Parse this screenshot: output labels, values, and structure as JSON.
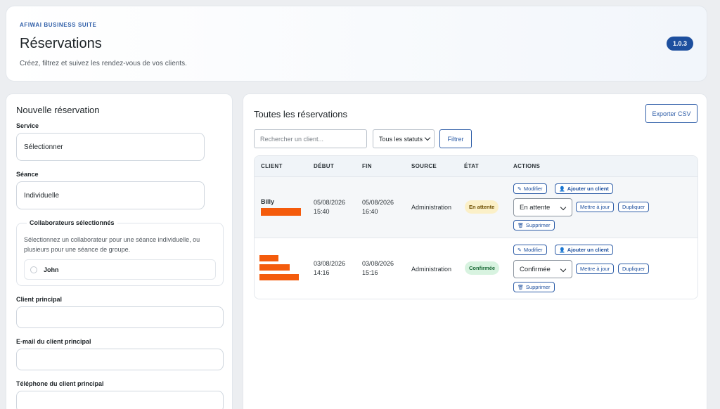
{
  "header": {
    "suite": "AFIWAI BUSINESS SUITE",
    "title": "Réservations",
    "description": "Créez, filtrez et suivez les rendez-vous de vos clients.",
    "version": "1.0.3"
  },
  "form": {
    "title": "Nouvelle réservation",
    "service_label": "Service",
    "service_value": "Sélectionner",
    "seance_label": "Séance",
    "seance_value": "Individuelle",
    "collab_title": "Collaborateurs sélectionnés",
    "collab_desc": "Sélectionnez un collaborateur pour une séance individuelle, ou plusieurs pour une séance de groupe.",
    "collaborators": [
      "John"
    ],
    "client_label": "Client principal",
    "email_label": "E-mail du client principal",
    "phone_label": "Téléphone du client principal"
  },
  "list": {
    "title": "Toutes les réservations",
    "export_label": "Exporter CSV",
    "search_placeholder": "Rechercher un client...",
    "status_filter": "Tous les statuts",
    "filter_label": "Filtrer",
    "columns": [
      "CLIENT",
      "DÉBUT",
      "FIN",
      "SOURCE",
      "ÉTAT",
      "ACTIONS"
    ],
    "rows": [
      {
        "client": "Billy",
        "start_date": "05/08/2026",
        "start_time": "15:40",
        "end_date": "05/08/2026",
        "end_time": "16:40",
        "source": "Administration",
        "status": "En attente",
        "state_select": "En attente"
      },
      {
        "client": "",
        "start_date": "03/08/2026",
        "start_time": "14:16",
        "end_date": "03/08/2026",
        "end_time": "15:16",
        "source": "Administration",
        "status": "Confirmée",
        "state_select": "Confirmée"
      }
    ],
    "actions": {
      "edit": "Modifier",
      "add_client": "Ajouter un client",
      "update": "Mettre à jour",
      "duplicate": "Dupliquer",
      "delete": "Supprimer"
    }
  },
  "colors": {
    "accent": "#2f5ea8",
    "version_badge": "#1d4f9e",
    "redaction": "#f45b0c",
    "pending_bg": "#fbf0c8",
    "confirmed_bg": "#d8f3e0"
  }
}
